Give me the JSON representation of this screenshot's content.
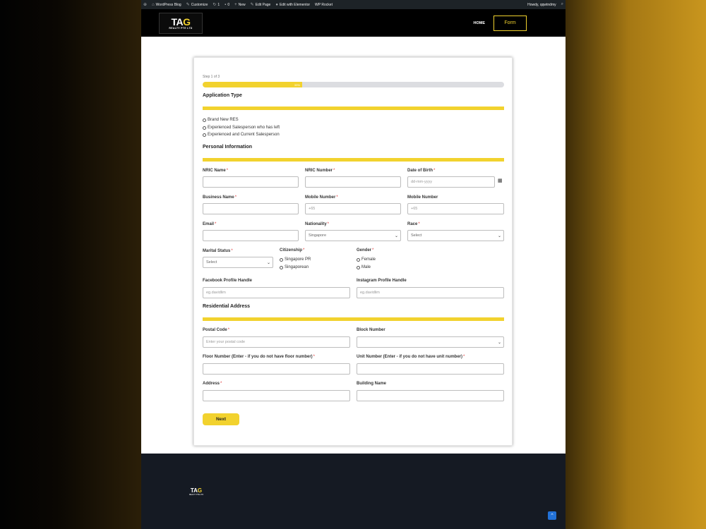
{
  "adminbar": {
    "items": [
      "WordPress Blog",
      "Customize",
      "1",
      "0",
      "New",
      "Edit Page",
      "Edit with Elementor",
      "WP Rocket"
    ],
    "greeting": "Howdy, qqwtndmy"
  },
  "header": {
    "logo_text_1": "TA",
    "logo_text_2": "G",
    "logo_sub": "REALTY PTE LTD",
    "nav_home": "HOME",
    "nav_form": "Form"
  },
  "form": {
    "step": "Step 1 of 3",
    "progress_label": "33%",
    "progress": 0.33,
    "application_type": {
      "title": "Application Type",
      "options": [
        "Brand New RES",
        "Experienced Salesperson who has left",
        "Experienced and Current Salesperson"
      ]
    },
    "personal": {
      "title": "Personal Information",
      "nric_name": "NRIC Name",
      "nric_number": "NRIC Number",
      "dob": "Date of Birth",
      "dob_placeholder": "dd-mm-yyyy",
      "business_name": "Business Name",
      "mobile_number_req": "Mobile Number",
      "mobile_number": "Mobile Number",
      "mobile_placeholder": "+65",
      "email": "Email",
      "nationality": "Nationality",
      "nationality_value": "Singapore",
      "race": "Race",
      "race_value": "Select",
      "marital_status": "Marital Status",
      "marital_value": "Select",
      "citizenship": "Citizenship",
      "citizenship_options": [
        "Singapore PR",
        "Singaporean"
      ],
      "gender": "Gender",
      "gender_options": [
        "Female",
        "Male"
      ],
      "facebook": "Facebook Profile Handle",
      "facebook_placeholder": "eg.davidlim",
      "instagram": "Instagram Profile Handle",
      "instagram_placeholder": "eg.davidlim"
    },
    "residential": {
      "title": "Residential Address",
      "postal_code": "Postal Code",
      "postal_placeholder": "Enter your postal code",
      "block_number": "Block Number",
      "floor_number": "Floor Number (Enter - if you do not have floor number)",
      "unit_number": "Unit Number (Enter - if you do not have unit number)",
      "address": "Address",
      "building_name": "Building Name"
    },
    "next": "Next",
    "required_mark": "*"
  },
  "footer": {
    "logo_text_1": "TA",
    "logo_text_2": "G",
    "logo_sub": "REALTY PTE LTD"
  },
  "colors": {
    "accent": "#f2d22e",
    "header_bg": "#000000",
    "footer_bg": "#151a23",
    "required": "#dd3333"
  }
}
